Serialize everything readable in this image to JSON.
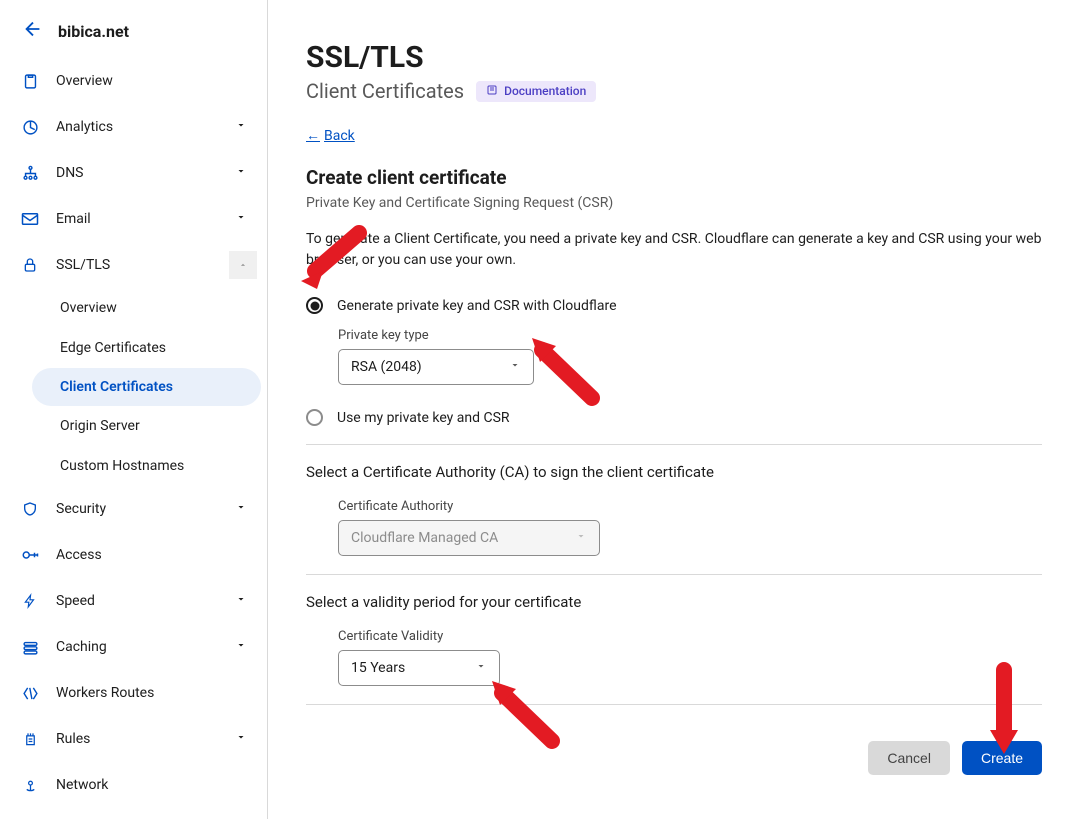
{
  "domainHeader": {
    "name": "bibica.net"
  },
  "sidebar": {
    "items": [
      {
        "label": "Overview"
      },
      {
        "label": "Analytics"
      },
      {
        "label": "DNS"
      },
      {
        "label": "Email"
      },
      {
        "label": "SSL/TLS"
      },
      {
        "label": "Security"
      },
      {
        "label": "Access"
      },
      {
        "label": "Speed"
      },
      {
        "label": "Caching"
      },
      {
        "label": "Workers Routes"
      },
      {
        "label": "Rules"
      },
      {
        "label": "Network"
      }
    ],
    "sslSub": [
      {
        "label": "Overview"
      },
      {
        "label": "Edge Certificates"
      },
      {
        "label": "Client Certificates"
      },
      {
        "label": "Origin Server"
      },
      {
        "label": "Custom Hostnames"
      }
    ]
  },
  "page": {
    "title": "SSL/TLS",
    "subtitle": "Client Certificates",
    "docLabel": "Documentation",
    "backLabel": "Back",
    "heading": "Create client certificate",
    "subhead": "Private Key and Certificate Signing Request (CSR)",
    "description": "To generate a Client Certificate, you need a private key and CSR. Cloudflare can generate a key and CSR using your web browser, or you can use your own.",
    "radioGenerate": "Generate private key and CSR with Cloudflare",
    "keyTypeLabel": "Private key type",
    "keyTypeValue": "RSA (2048)",
    "radioOwn": "Use my private key and CSR",
    "caHeading": "Select a Certificate Authority (CA) to sign the client certificate",
    "caLabel": "Certificate Authority",
    "caValue": "Cloudflare Managed CA",
    "validityHeading": "Select a validity period for your certificate",
    "validityLabel": "Certificate Validity",
    "validityValue": "15 Years",
    "cancelLabel": "Cancel",
    "createLabel": "Create"
  }
}
